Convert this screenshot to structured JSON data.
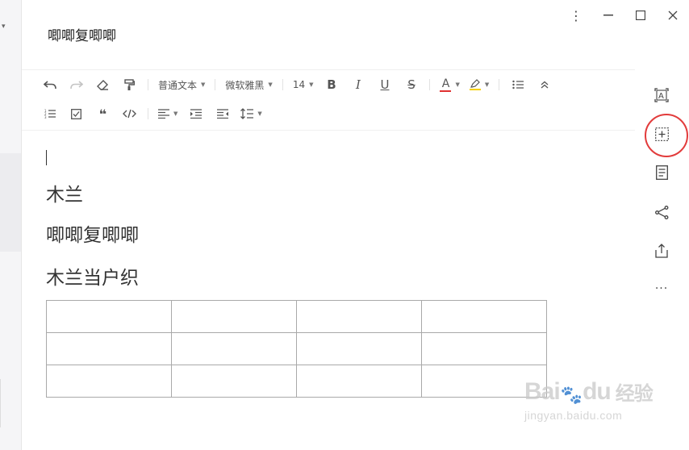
{
  "window": {
    "controls": {
      "more": "⋮",
      "minimize": "—",
      "maximize": "☐",
      "close": "✕"
    }
  },
  "document": {
    "title": "唧唧复唧唧",
    "paragraphs": [
      "木兰",
      "唧唧复唧唧",
      "木兰当户织"
    ],
    "table": {
      "rows": 3,
      "cols": 4
    }
  },
  "toolbar": {
    "paragraph_style": "普通文本",
    "font_family": "微软雅黑",
    "font_size": "14",
    "bold": "B",
    "italic": "I",
    "underline": "U",
    "strikethrough": "S",
    "font_color": "A",
    "font_color_value": "#e03131",
    "highlight_color_value": "#f5d000"
  },
  "right_rail": {
    "icons": [
      "text-box-icon",
      "insert-block-icon",
      "document-outline-icon",
      "share-icon",
      "export-icon",
      "more-icon"
    ],
    "more_label": "···"
  },
  "watermark": {
    "brand_left": "Bai",
    "brand_right": "du",
    "brand_cn": "经验",
    "url": "jingyan.baidu.com"
  },
  "colors": {
    "highlight_ring": "#e23b3b",
    "table_border": "#a9a9a9"
  }
}
